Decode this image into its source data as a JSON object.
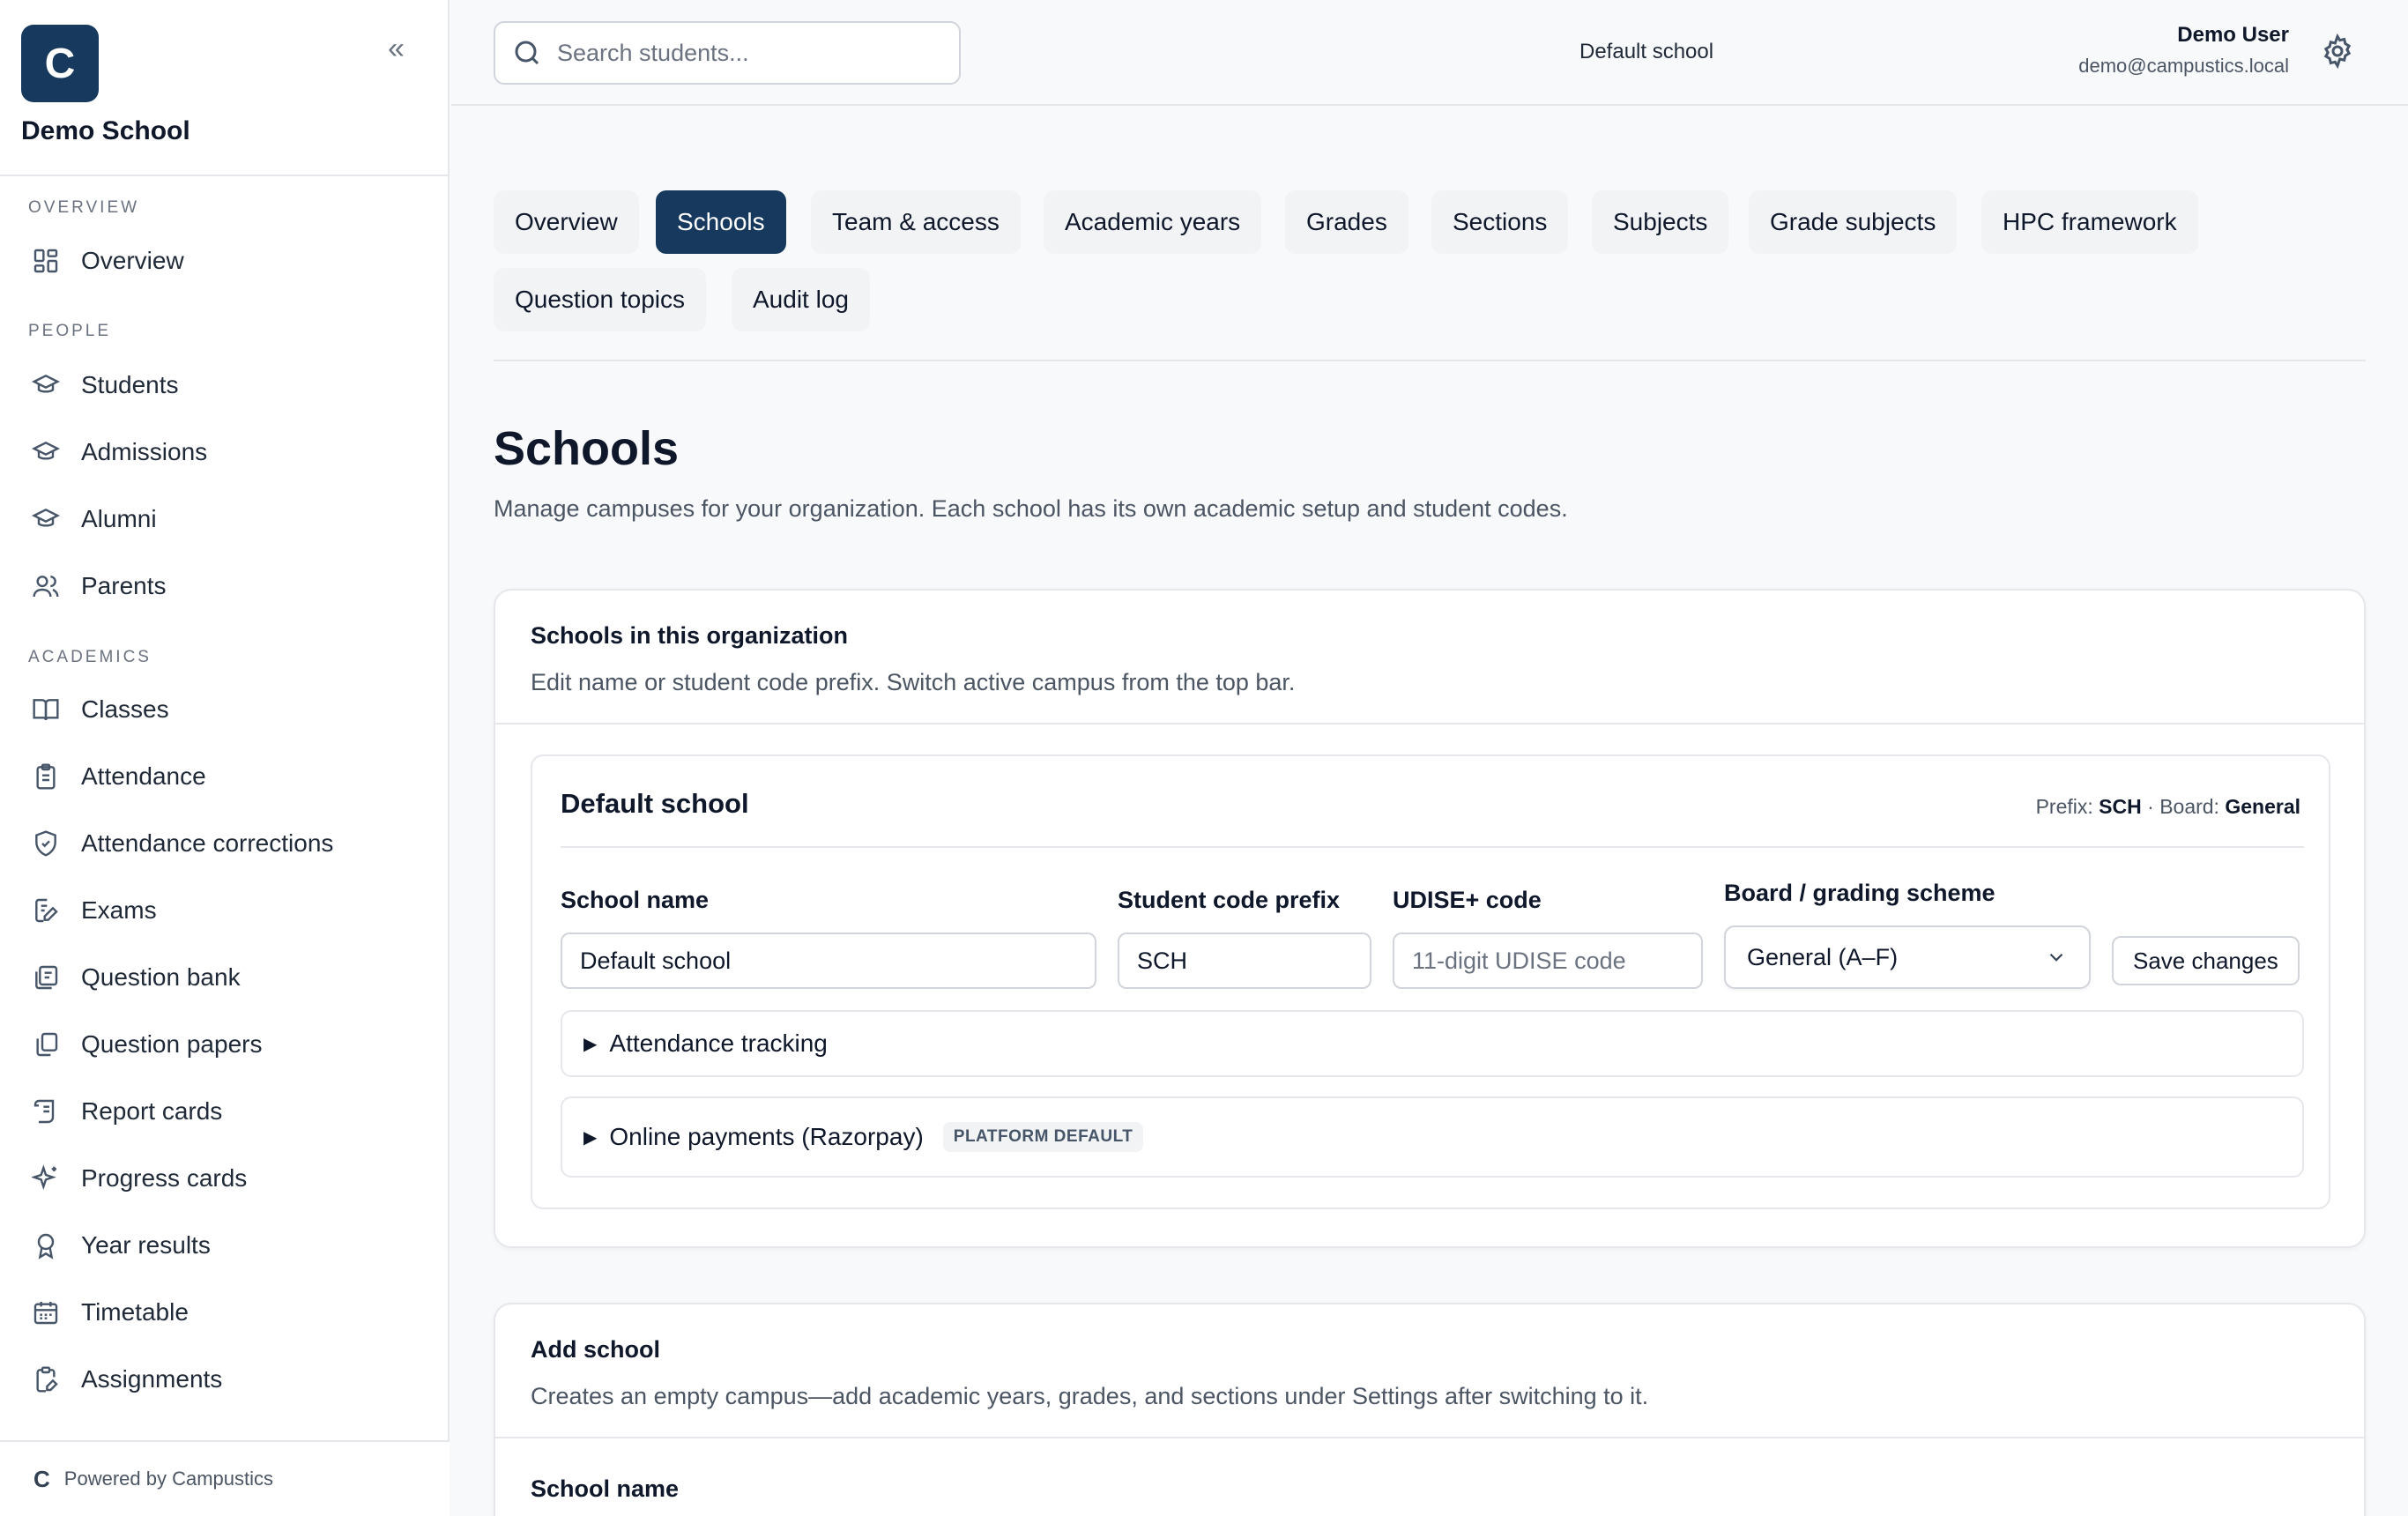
{
  "sidebar": {
    "brand_letter": "C",
    "collapse_glyph": "«",
    "school_name": "Demo School",
    "sections": [
      {
        "label": "OVERVIEW"
      },
      {
        "label": "PEOPLE"
      },
      {
        "label": "ACADEMICS"
      }
    ],
    "items": [
      {
        "label": "Overview",
        "icon": "layout-grid-icon"
      },
      {
        "label": "Students",
        "icon": "graduation-cap-icon"
      },
      {
        "label": "Admissions",
        "icon": "graduation-cap-icon"
      },
      {
        "label": "Alumni",
        "icon": "graduation-cap-icon"
      },
      {
        "label": "Parents",
        "icon": "users-icon"
      },
      {
        "label": "Classes",
        "icon": "book-open-icon"
      },
      {
        "label": "Attendance",
        "icon": "clipboard-list-icon"
      },
      {
        "label": "Attendance corrections",
        "icon": "shield-check-icon"
      },
      {
        "label": "Exams",
        "icon": "file-edit-icon"
      },
      {
        "label": "Question bank",
        "icon": "book-copy-icon"
      },
      {
        "label": "Question papers",
        "icon": "files-icon"
      },
      {
        "label": "Report cards",
        "icon": "scroll-icon"
      },
      {
        "label": "Progress cards",
        "icon": "sparkles-icon"
      },
      {
        "label": "Year results",
        "icon": "award-icon"
      },
      {
        "label": "Timetable",
        "icon": "calendar-icon"
      },
      {
        "label": "Assignments",
        "icon": "clipboard-pen-icon"
      }
    ],
    "footer": {
      "logo": "C",
      "text": "Powered by Campustics"
    }
  },
  "topbar": {
    "search_placeholder": "Search students...",
    "active_school": "Default school",
    "user_name": "Demo User",
    "user_email": "demo@campustics.local"
  },
  "tabs": [
    {
      "label": "Overview",
      "active": false
    },
    {
      "label": "Schools",
      "active": true
    },
    {
      "label": "Team & access",
      "active": false
    },
    {
      "label": "Academic years",
      "active": false
    },
    {
      "label": "Grades",
      "active": false
    },
    {
      "label": "Sections",
      "active": false
    },
    {
      "label": "Subjects",
      "active": false
    },
    {
      "label": "Grade subjects",
      "active": false
    },
    {
      "label": "HPC framework",
      "active": false
    },
    {
      "label": "Question topics",
      "active": false
    },
    {
      "label": "Audit log",
      "active": false
    }
  ],
  "page": {
    "title": "Schools",
    "description": "Manage campuses for your organization. Each school has its own academic setup and student codes."
  },
  "org_card": {
    "title": "Schools in this organization",
    "description": "Edit name or student code prefix. Switch active campus from the top bar.",
    "school": {
      "name": "Default school",
      "meta_prefix_label": "Prefix:",
      "meta_prefix": "SCH",
      "meta_sep": "·",
      "meta_board_label": "Board:",
      "meta_board": "General",
      "fields": {
        "school_name_label": "School name",
        "school_name_value": "Default school",
        "prefix_label": "Student code prefix",
        "prefix_value": "SCH",
        "udise_label": "UDISE+ code",
        "udise_placeholder": "11-digit UDISE code",
        "board_label": "Board / grading scheme",
        "board_value": "General (A–F)"
      },
      "save_label": "Save changes",
      "attendance_label": "Attendance tracking",
      "payments_label": "Online payments (Razorpay)",
      "payments_badge": "PLATFORM DEFAULT"
    }
  },
  "add_card": {
    "title": "Add school",
    "description": "Creates an empty campus—add academic years, grades, and sections under Settings after switching to it.",
    "school_name_label": "School name"
  },
  "colors": {
    "brand": "#17395e",
    "tab_active_bg": "#17395e",
    "tab_bg": "#f1f3f5",
    "border": "#e5e7eb"
  }
}
